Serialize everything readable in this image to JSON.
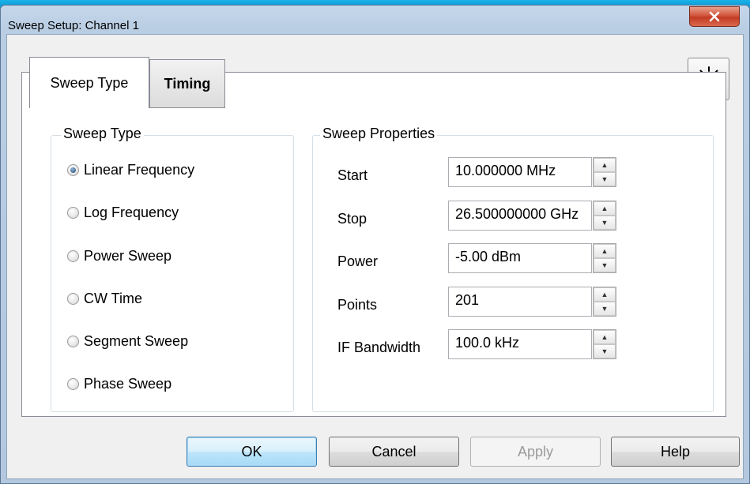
{
  "window": {
    "title": "Sweep Setup: Channel 1",
    "close_glyph": "x"
  },
  "tabs": [
    {
      "label": "Sweep Type",
      "active": true
    },
    {
      "label": "Timing",
      "active": false
    }
  ],
  "sweep_type_group": {
    "label": "Sweep Type",
    "options": [
      {
        "label": "Linear Frequency",
        "selected": true
      },
      {
        "label": "Log Frequency",
        "selected": false
      },
      {
        "label": "Power Sweep",
        "selected": false
      },
      {
        "label": "CW Time",
        "selected": false
      },
      {
        "label": "Segment Sweep",
        "selected": false
      },
      {
        "label": "Phase Sweep",
        "selected": false
      }
    ]
  },
  "sweep_properties": {
    "label": "Sweep Properties",
    "fields": [
      {
        "label": "Start",
        "value": "10.000000 MHz"
      },
      {
        "label": "Stop",
        "value": "26.500000000 GHz"
      },
      {
        "label": "Power",
        "value": "-5.00 dBm"
      },
      {
        "label": "Points",
        "value": "201"
      },
      {
        "label": "IF Bandwidth",
        "value": "100.0 kHz"
      }
    ]
  },
  "buttons": {
    "ok": "OK",
    "cancel": "Cancel",
    "apply": "Apply",
    "help": "Help"
  },
  "icons": {
    "close": "close-icon",
    "light": "light-icon",
    "spin_up": "chevron-up-icon",
    "spin_down": "chevron-down-icon"
  },
  "colors": {
    "accent_blue": "#3c7fb1",
    "close_red": "#c23b22"
  }
}
